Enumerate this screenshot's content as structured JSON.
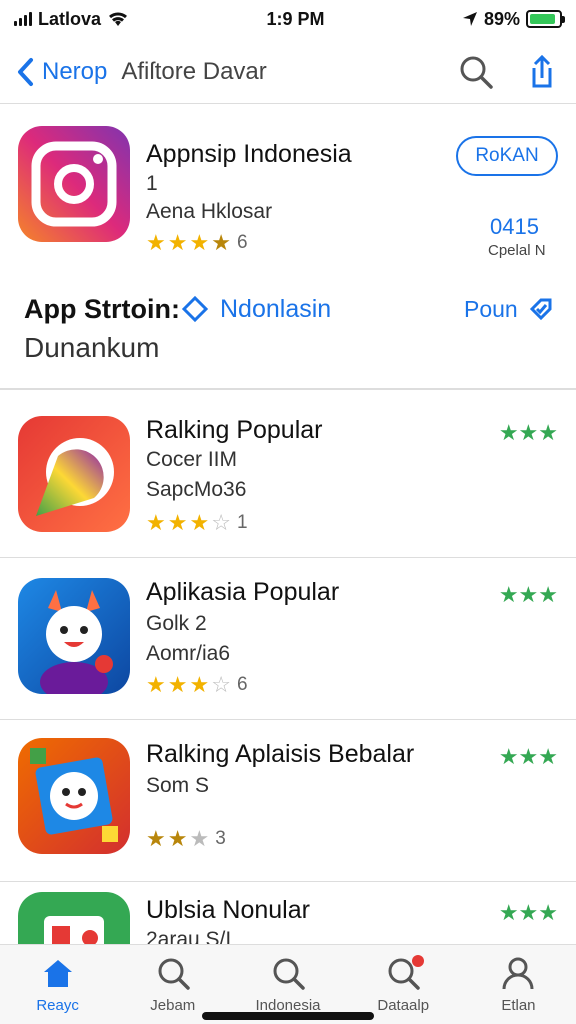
{
  "status_bar": {
    "carrier": "Latlova",
    "time": "1:9 PM",
    "battery": "89%",
    "battery_level": 0.89
  },
  "nav": {
    "back_label": "Nerop",
    "title": "Afiſtore Davar"
  },
  "featured": {
    "name": "Appnsip Indonesia",
    "line1": "1",
    "line2": "Aena Hklosar",
    "rating": {
      "filled": 3,
      "half": 1,
      "count": "6"
    },
    "get_label": "RoKAN",
    "score": "0415",
    "score_label": "Cpelal N"
  },
  "section": {
    "title": "App Strtoin:",
    "tag_label": "Ndonlasin",
    "subtitle": "Dunankum",
    "more_label": "Poun"
  },
  "apps": [
    {
      "name": "Ralking Popular",
      "line1": "Cocer IIM",
      "line2": "SapcMo36",
      "rating_count": "1",
      "filled": 3,
      "half": 0,
      "empty": 1,
      "right_stars": "★★★"
    },
    {
      "name": "Aplikasia Popular",
      "line1": "Golk 2",
      "line2": "Aomr/ia6",
      "rating_count": "6",
      "filled": 3,
      "half": 0,
      "empty": 2,
      "right_stars": "★★★"
    },
    {
      "name": "Ralking Aplaisis Bebalar",
      "line1": "Som S",
      "line2": "",
      "rating_count": "3",
      "filled": 2,
      "half": 0,
      "empty": 2,
      "right_stars": "★★★"
    },
    {
      "name": "Ublsia Nonular",
      "line1": "2arau S/I",
      "line2": "",
      "rating_count": "",
      "filled": 0,
      "half": 0,
      "empty": 0,
      "right_stars": "★★★"
    }
  ],
  "tabs": [
    {
      "label": "Reayc",
      "icon": "home-icon",
      "active": true
    },
    {
      "label": "Jebam",
      "icon": "search-icon"
    },
    {
      "label": "Indonesia",
      "icon": "search-icon"
    },
    {
      "label": "Dataalp",
      "icon": "search-icon"
    },
    {
      "label": "Etlan",
      "icon": "person-icon"
    }
  ],
  "colors": {
    "accent": "#1a73e8",
    "star": "#f2b200",
    "green": "#34a853"
  }
}
